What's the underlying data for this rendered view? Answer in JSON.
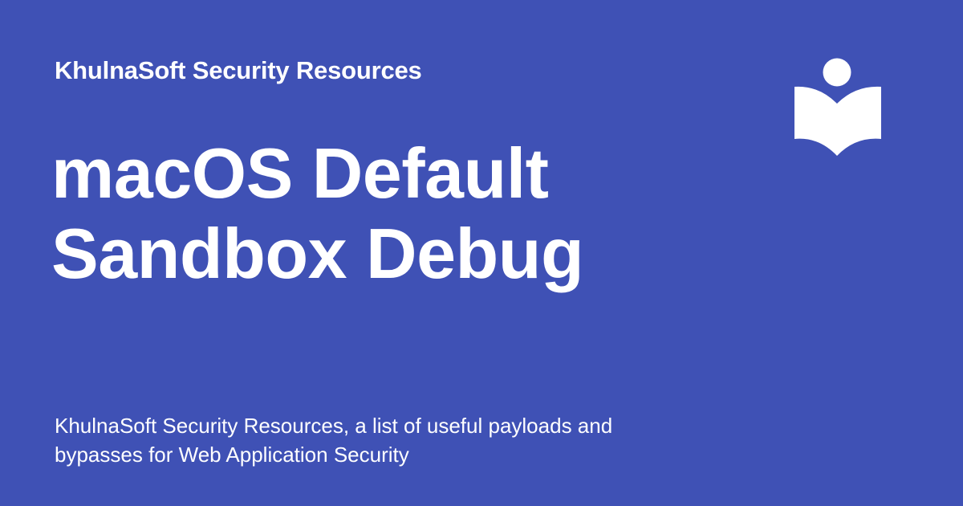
{
  "site_name": "KhulnaSoft Security Resources",
  "title_lines": [
    "macOS Default",
    "Sandbox Debug"
  ],
  "description": "KhulnaSoft Security Resources, a list of useful payloads and bypasses for Web Application Security",
  "logo_icon": "book-reader-icon",
  "colors": {
    "background": "#3f51b5",
    "foreground": "#ffffff"
  }
}
